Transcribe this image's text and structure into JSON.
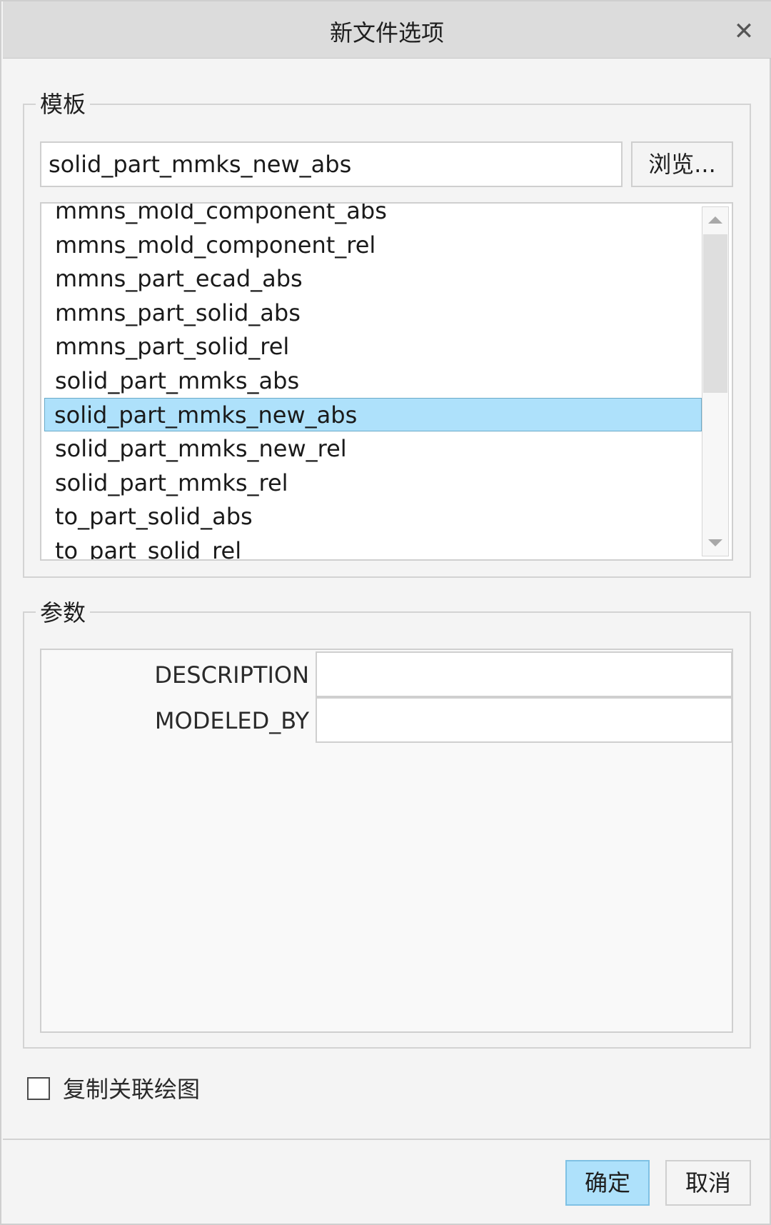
{
  "dialog": {
    "title": "新文件选项"
  },
  "template": {
    "legend": "模板",
    "input_value": "solid_part_mmks_new_abs",
    "browse_label": "浏览...",
    "list_items": [
      "mmns_mold_component_abs",
      "mmns_mold_component_rel",
      "mmns_part_ecad_abs",
      "mmns_part_solid_abs",
      "mmns_part_solid_rel",
      "solid_part_mmks_abs",
      "solid_part_mmks_new_abs",
      "solid_part_mmks_new_rel",
      "solid_part_mmks_rel",
      "to_part_solid_abs",
      "to_part_solid_rel"
    ],
    "selected_index": 6
  },
  "params": {
    "legend": "参数",
    "rows": [
      {
        "label": "DESCRIPTION",
        "value": ""
      },
      {
        "label": "MODELED_BY",
        "value": ""
      }
    ]
  },
  "copy_drawing": {
    "label": "复制关联绘图",
    "checked": false
  },
  "buttons": {
    "ok": "确定",
    "cancel": "取消"
  },
  "colors": {
    "selection": "#aee1fb",
    "ok_button": "#aee1fb",
    "titlebar": "#dcdcdc"
  },
  "icons": {
    "close": "close-icon",
    "scroll_up": "scroll-up-icon",
    "scroll_down": "scroll-down-icon"
  }
}
